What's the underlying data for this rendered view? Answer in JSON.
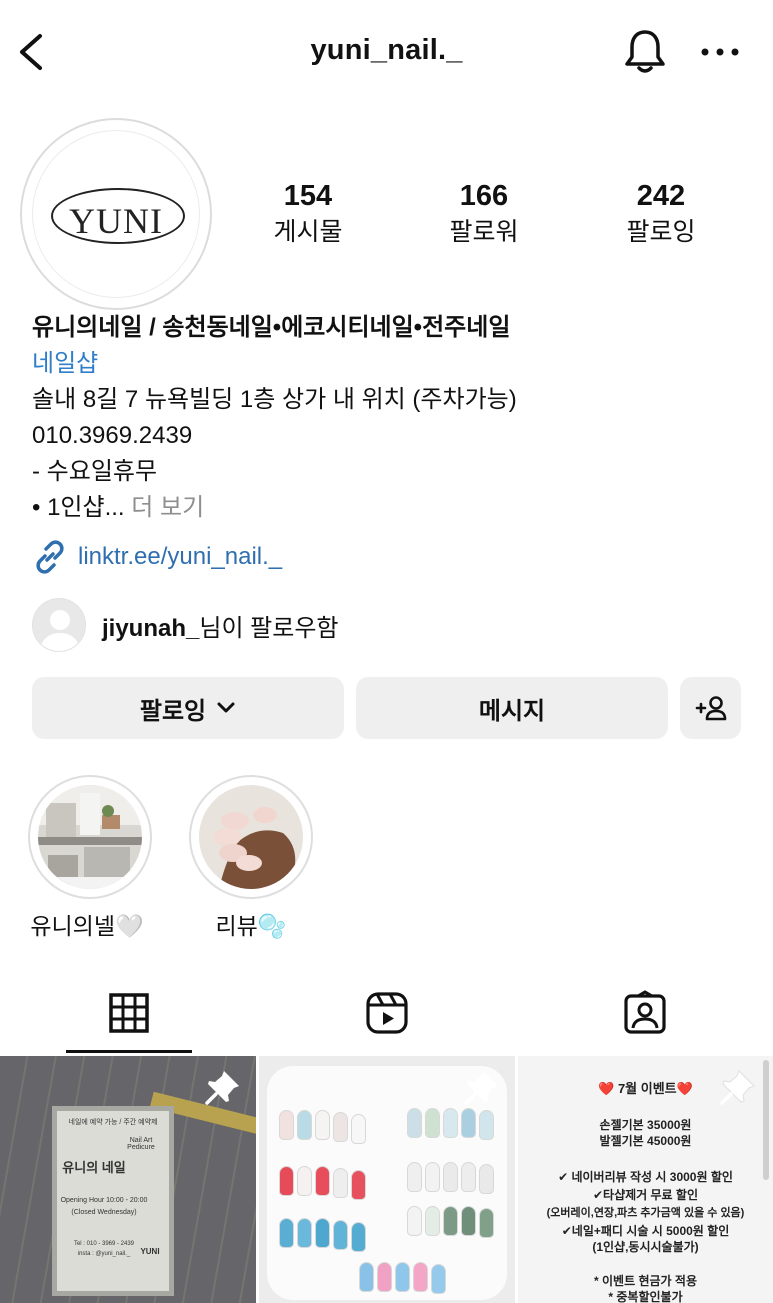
{
  "header": {
    "username": "yuni_nail._"
  },
  "profile": {
    "avatar_logo_text": "YUNI",
    "stats": [
      {
        "value": "154",
        "label": "게시물"
      },
      {
        "value": "166",
        "label": "팔로워"
      },
      {
        "value": "242",
        "label": "팔로잉"
      }
    ],
    "bio": {
      "name": "유니의네일 / 송천동네일•에코시티네일•전주네일",
      "category": "네일샵",
      "address": "솔내 8길 7 뉴욕빌딩 1층 상가 내 위치 (주차가능)",
      "phone": "010.3969.2439",
      "line_closed": "- 수요일휴무",
      "line_truncated": "• 1인샵...",
      "more_label": "더 보기"
    },
    "link": "linktr.ee/yuni_nail._",
    "followed_by": {
      "user": "jiyunah_",
      "suffix": "님이 팔로우함"
    }
  },
  "actions": {
    "follow_label": "팔로잉",
    "message_label": "메시지",
    "add_label": "+옷"
  },
  "highlights": [
    {
      "label": "유니의넬🤍"
    },
    {
      "label": "리뷰🫧"
    }
  ],
  "tabs": [
    "grid-icon",
    "reels-icon",
    "tagged-icon"
  ],
  "posts": {
    "post1": {
      "sign_small": "네일에 예약 가능 / 주간 예약제",
      "sign_name": "유니의 네일",
      "sign_side": "Nail Art Pedicure",
      "sign_hours": "Opening Hour 10:00 - 20:00",
      "sign_closed": "(Closed Wednesday)",
      "sign_tel": "Tel : 010 - 3969 - 2439",
      "sign_insta": "insta : @yuni_nail._",
      "sign_logo": "YUNI"
    },
    "post3": {
      "title": "❤️ 7월 이벤트❤️",
      "line1": "손젤기본 35000원",
      "line2": "발젤기본 45000원",
      "line3": "✔ 네이버리뷰 작성 시 3000원 할인",
      "line4": "✔타샵제거 무료 할인",
      "line5": "(오버레이,연장,파츠 추가금액 있을 수 있음)",
      "line6": "✔네일+패디 시술 시 5000원 할인",
      "line7": "(1인샵,동시시술불가)",
      "line8": "* 이벤트 현금가 적용",
      "line9": "* 중복할인불가"
    }
  }
}
